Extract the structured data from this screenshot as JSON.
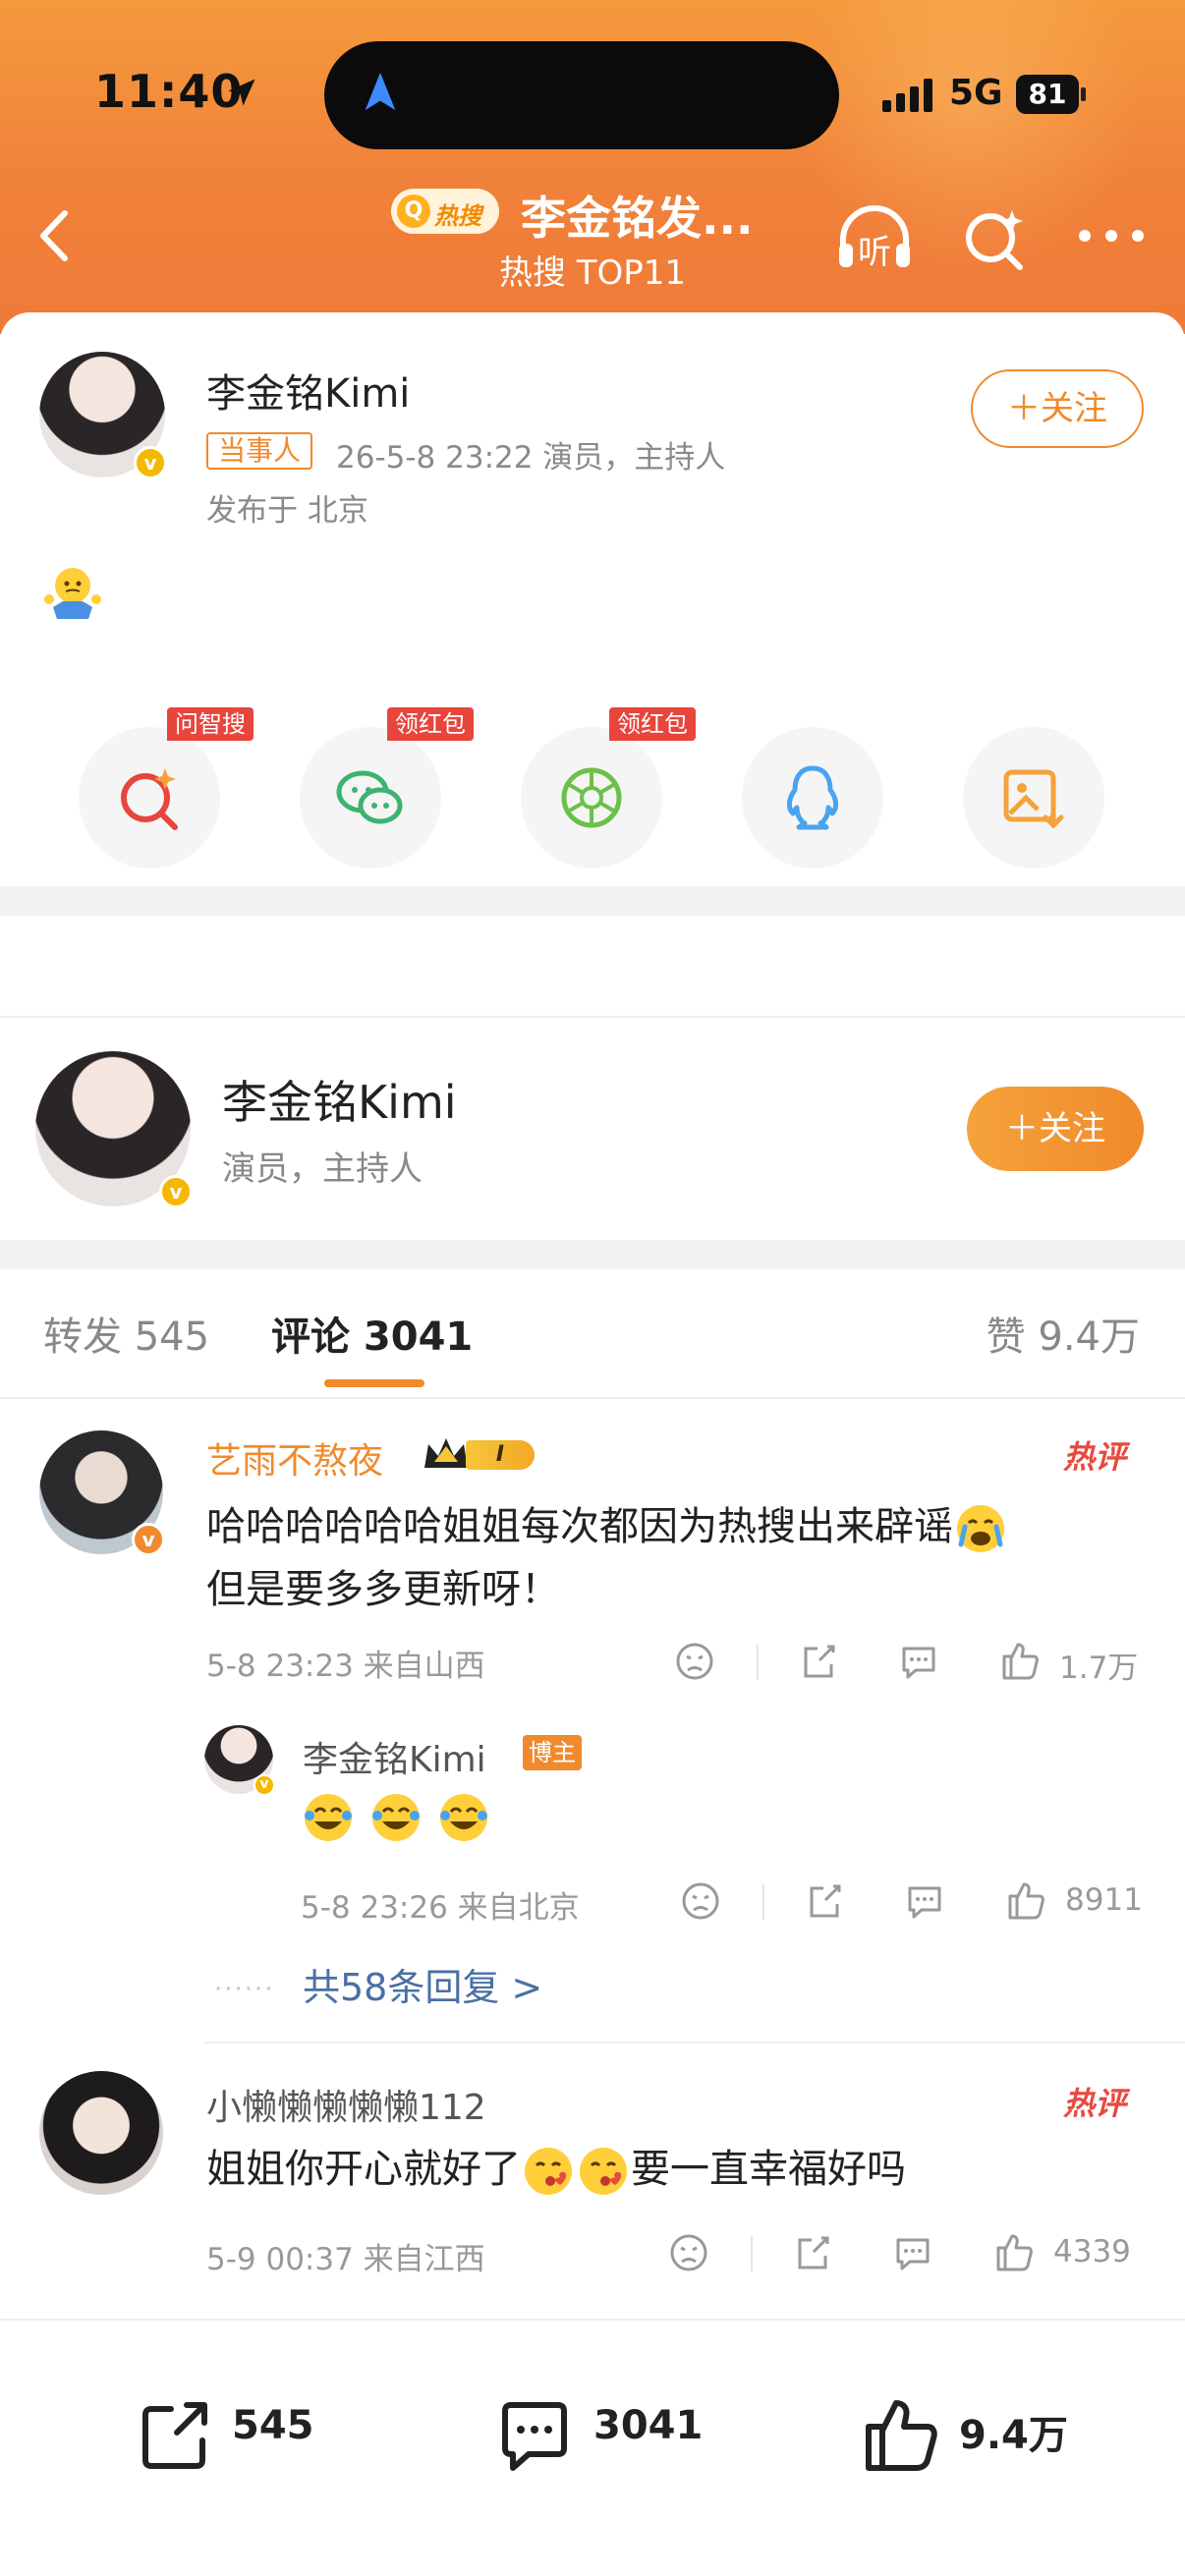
{
  "status_bar": {
    "time": "11:40",
    "network": "5G",
    "battery": "81"
  },
  "nav": {
    "hot_chip": "热搜",
    "title": "李金铭发...",
    "subtitle": "热搜 TOP11",
    "listen_label": "听"
  },
  "post": {
    "author": "李金铭Kimi",
    "author_tag": "当事人",
    "meta": "26-5-8 23:22  演员，主持人",
    "location": "发布于 北京",
    "follow_label": "＋关注",
    "share_badges": [
      "问智搜",
      "领红包",
      "领红包"
    ]
  },
  "author_card": {
    "name": "李金铭Kimi",
    "desc": "演员，主持人",
    "follow_label": "＋关注"
  },
  "tabs": {
    "repost": "转发 545",
    "comments": "评论 3041",
    "likes": "赞 9.4万"
  },
  "comments": [
    {
      "user": "艺雨不熬夜",
      "level": "I",
      "hot": "热评",
      "text_line1": "哈哈哈哈哈哈姐姐每次都因为热搜出来辟谣",
      "text_line2": "但是要多多更新呀！",
      "meta": "5-8 23:23  来自山西",
      "likes": "1.7万"
    },
    {
      "user": "小懒懒懒懒懒112",
      "hot": "热评",
      "text_part1": "姐姐你开心就好了",
      "text_part2": "要一直幸福好吗",
      "meta": "5-9 00:37  来自江西",
      "likes": "4339"
    }
  ],
  "reply": {
    "user": "李金铭Kimi",
    "tag": "博主",
    "meta": "5-8 23:26  来自北京",
    "likes": "8911",
    "more": "共58条回复 >"
  },
  "bottom_bar": {
    "reposts": "545",
    "comments": "3041",
    "likes": "9.4万"
  },
  "colors": {
    "accent": "#f08a2c",
    "hot_red": "#e84a3f",
    "link_blue": "#4a6fa5"
  }
}
